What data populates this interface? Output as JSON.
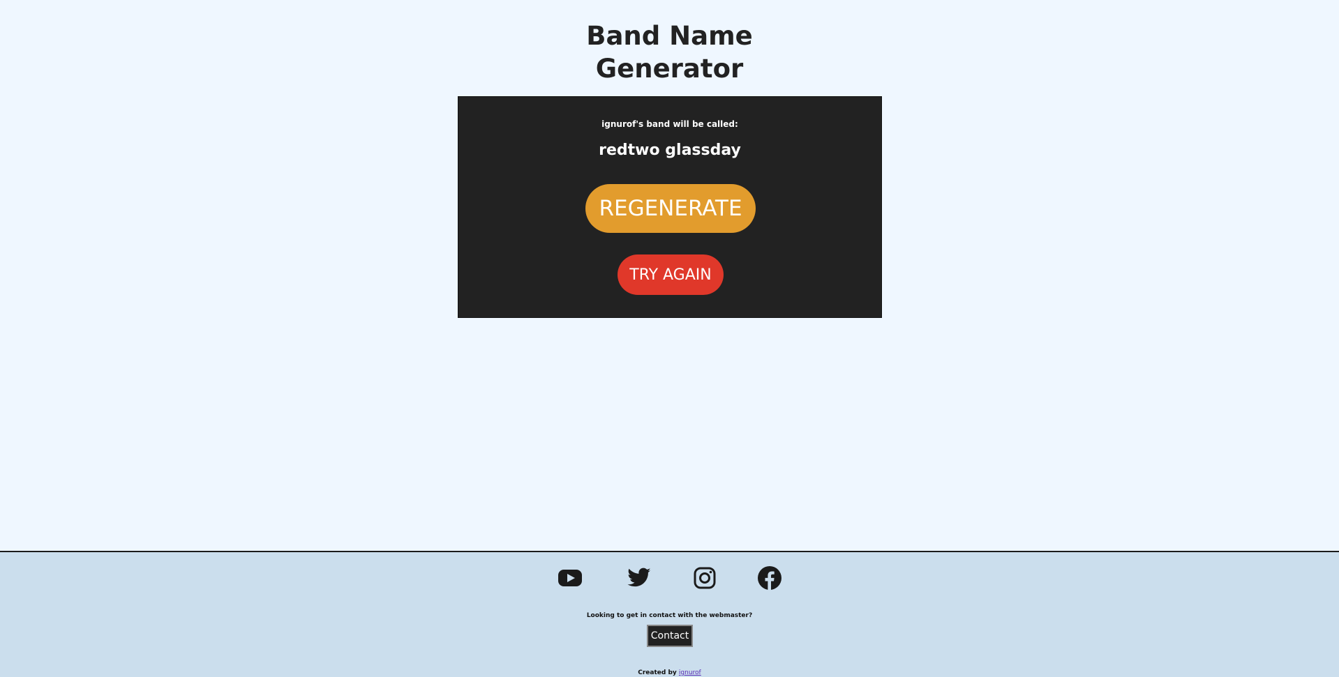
{
  "header": {
    "title_line1": "Band Name",
    "title_line2": "Generator"
  },
  "generator": {
    "intro": "ignurof's band will be called:",
    "band_name": "redtwo glassday",
    "regenerate_label": "REGENERATE",
    "try_again_label": "TRY AGAIN"
  },
  "footer": {
    "social_icons": [
      "youtube-icon",
      "twitter-icon",
      "instagram-icon",
      "facebook-icon"
    ],
    "contact_prompt": "Looking to get in contact with the webmaster?",
    "contact_label": "Contact",
    "created_prefix": "Created by",
    "author_link": "ignurof"
  },
  "colors": {
    "background": "#eff7ff",
    "card": "#222222",
    "regenerate": "#e29c2d",
    "try_again": "#e0382a",
    "footer": "#cbdeed",
    "link": "#5a2fb6"
  }
}
